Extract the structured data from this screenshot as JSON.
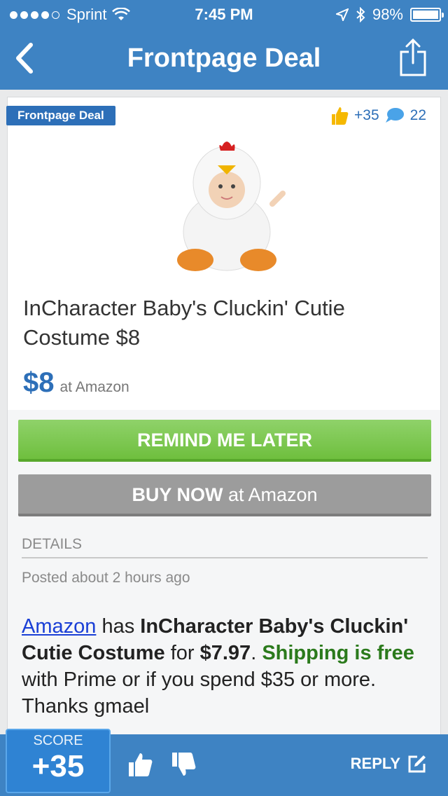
{
  "status": {
    "carrier": "Sprint",
    "time": "7:45 PM",
    "battery": "98%"
  },
  "nav": {
    "title": "Frontpage Deal"
  },
  "deal": {
    "badge": "Frontpage Deal",
    "thumbs": "+35",
    "comments": "22",
    "title": "InCharacter Baby's Cluckin' Cutie Costume $8",
    "price": "$8",
    "store": "at Amazon"
  },
  "actions": {
    "remind": "REMIND ME LATER",
    "buy_bold": "BUY NOW",
    "buy_rest": " at Amazon"
  },
  "details": {
    "label": "DETAILS",
    "posted": "Posted about 2 hours ago",
    "desc": {
      "link": "Amazon",
      "t1": " has ",
      "product": "InCharacter Baby's Cluckin' Cutie Costume",
      "t2": " for ",
      "price": "$7.97",
      "t3": ". ",
      "shipping": "Shipping is free",
      "t4": " with Prime or if you spend $35 or more. Thanks gmael"
    }
  },
  "bottom": {
    "score_label": "SCORE",
    "score_value": "+35",
    "reply": "REPLY"
  },
  "colors": {
    "brand": "#3e83c3",
    "accent": "#2d6fb8",
    "remind": "#7cc84f",
    "buy": "#9c9c9c"
  }
}
